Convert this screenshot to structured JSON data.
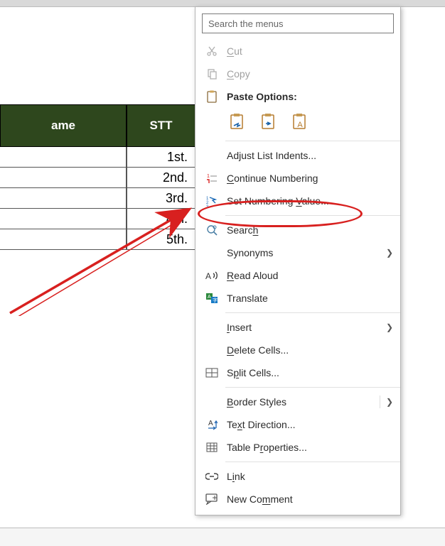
{
  "table": {
    "colA_header": "ame",
    "colB_header": "STT",
    "rows": [
      "1st.",
      "2nd.",
      "3rd.",
      "4th.",
      "5th."
    ]
  },
  "menu": {
    "search_placeholder": "Search the menus",
    "cut": "Cut",
    "copy": "Copy",
    "paste_options": "Paste Options:",
    "adjust_list": "Adjust List Indents...",
    "continue_numbering": "Continue Numbering",
    "set_numbering": "Set Numbering Value...",
    "search": "Search",
    "synonyms": "Synonyms",
    "read_aloud": "Read Aloud",
    "translate": "Translate",
    "insert": "Insert",
    "delete_cells": "Delete Cells...",
    "split_cells": "Split Cells...",
    "border_styles": "Border Styles",
    "text_direction": "Text Direction...",
    "table_properties": "Table Properties...",
    "link": "Link",
    "new_comment": "New Comment"
  },
  "accent_red": "#d8201f"
}
